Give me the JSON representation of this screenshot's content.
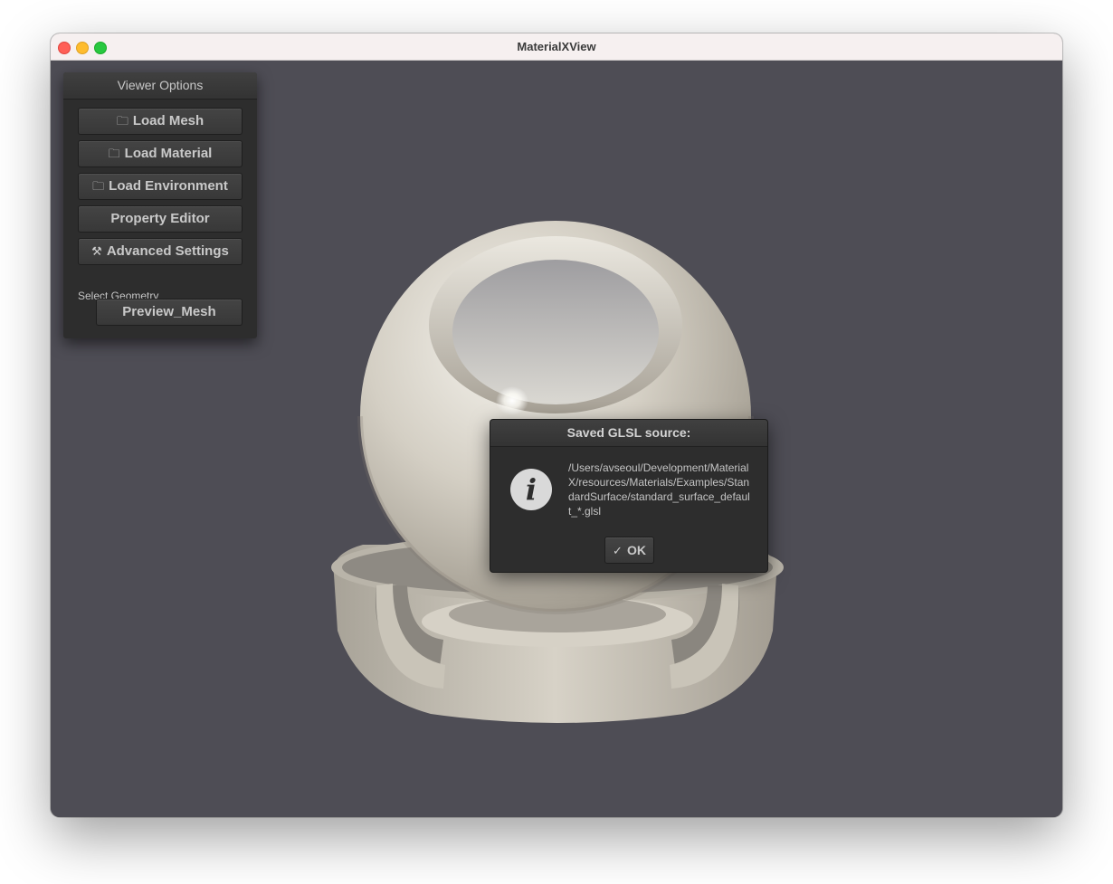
{
  "window": {
    "title": "MaterialXView"
  },
  "panel": {
    "title": "Viewer Options",
    "buttons": [
      {
        "label": "Load Mesh",
        "icon": "folder-icon"
      },
      {
        "label": "Load Material",
        "icon": "folder-icon"
      },
      {
        "label": "Load Environment",
        "icon": "folder-icon"
      },
      {
        "label": "Property Editor",
        "icon": ""
      },
      {
        "label": "Advanced Settings",
        "icon": "tools-icon"
      }
    ],
    "geometry_label": "Select Geometry",
    "geometry_value": "Preview_Mesh"
  },
  "dialog": {
    "title": "Saved GLSL source:",
    "icon": "info-icon",
    "message": "/Users/avseoul/Development/MaterialX/resources/Materials/Examples/StandardSurface/standard_surface_default_*.glsl",
    "ok_label": "OK",
    "ok_icon": "checkmark-icon"
  },
  "colors": {
    "viewport_bg": "#4e4d55",
    "panel_bg": "#2d2d2d",
    "material_base": "#d2cdc1"
  }
}
